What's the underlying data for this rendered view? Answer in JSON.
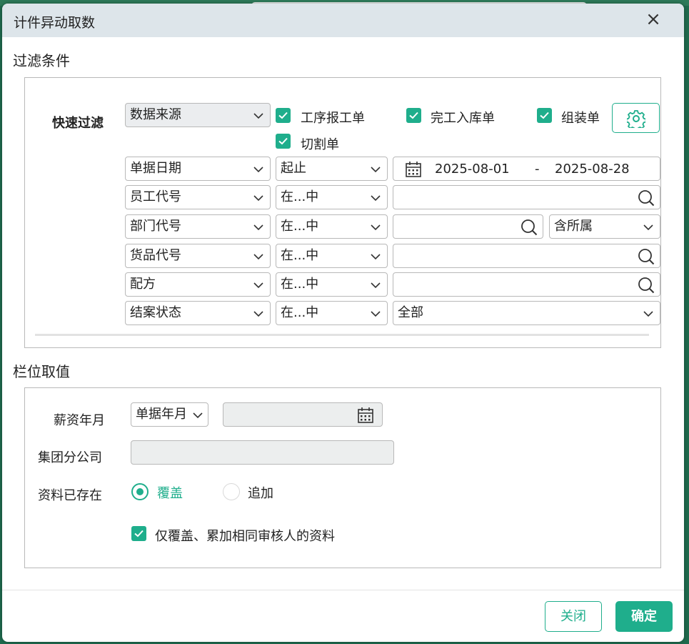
{
  "dialog": {
    "title": "计件异动取数"
  },
  "filter_section": {
    "title": "过滤条件",
    "quick_filter_label": "快速过滤",
    "data_source_select": "数据来源",
    "checkboxes": [
      {
        "label": "工序报工单",
        "checked": true
      },
      {
        "label": "完工入库单",
        "checked": true
      },
      {
        "label": "组装单",
        "checked": true
      },
      {
        "label": "切割单",
        "checked": true
      }
    ],
    "rows": [
      {
        "field": "单据日期",
        "operator": "起止",
        "date_from": "2025-08-01",
        "date_sep": "-",
        "date_to": "2025-08-28"
      },
      {
        "field": "员工代号",
        "operator": "在...中",
        "value": ""
      },
      {
        "field": "部门代号",
        "operator": "在...中",
        "value": "",
        "scope": "含所属"
      },
      {
        "field": "货品代号",
        "operator": "在...中",
        "value": ""
      },
      {
        "field": "配方",
        "operator": "在...中",
        "value": ""
      },
      {
        "field": "结案状态",
        "operator": "在...中",
        "value": "全部"
      }
    ]
  },
  "column_section": {
    "title": "栏位取值",
    "salary_month_label": "薪资年月",
    "salary_month_select": "单据年月",
    "group_company_label": "集团分公司",
    "exists_label": "资料已存在",
    "radio_overwrite": "覆盖",
    "radio_append": "追加",
    "selected_mode": "覆盖",
    "same_reviewer_checkbox": "仅覆盖、累加相同审核人的资料",
    "same_reviewer_checked": true
  },
  "footer": {
    "close_label": "关闭",
    "ok_label": "确定"
  },
  "colors": {
    "accent": "#1fae8c",
    "title_bar": "#dde5ea"
  },
  "icons": [
    "close-icon",
    "gear-icon",
    "calendar-icon",
    "search-icon",
    "chevron-down-icon",
    "check-icon"
  ]
}
